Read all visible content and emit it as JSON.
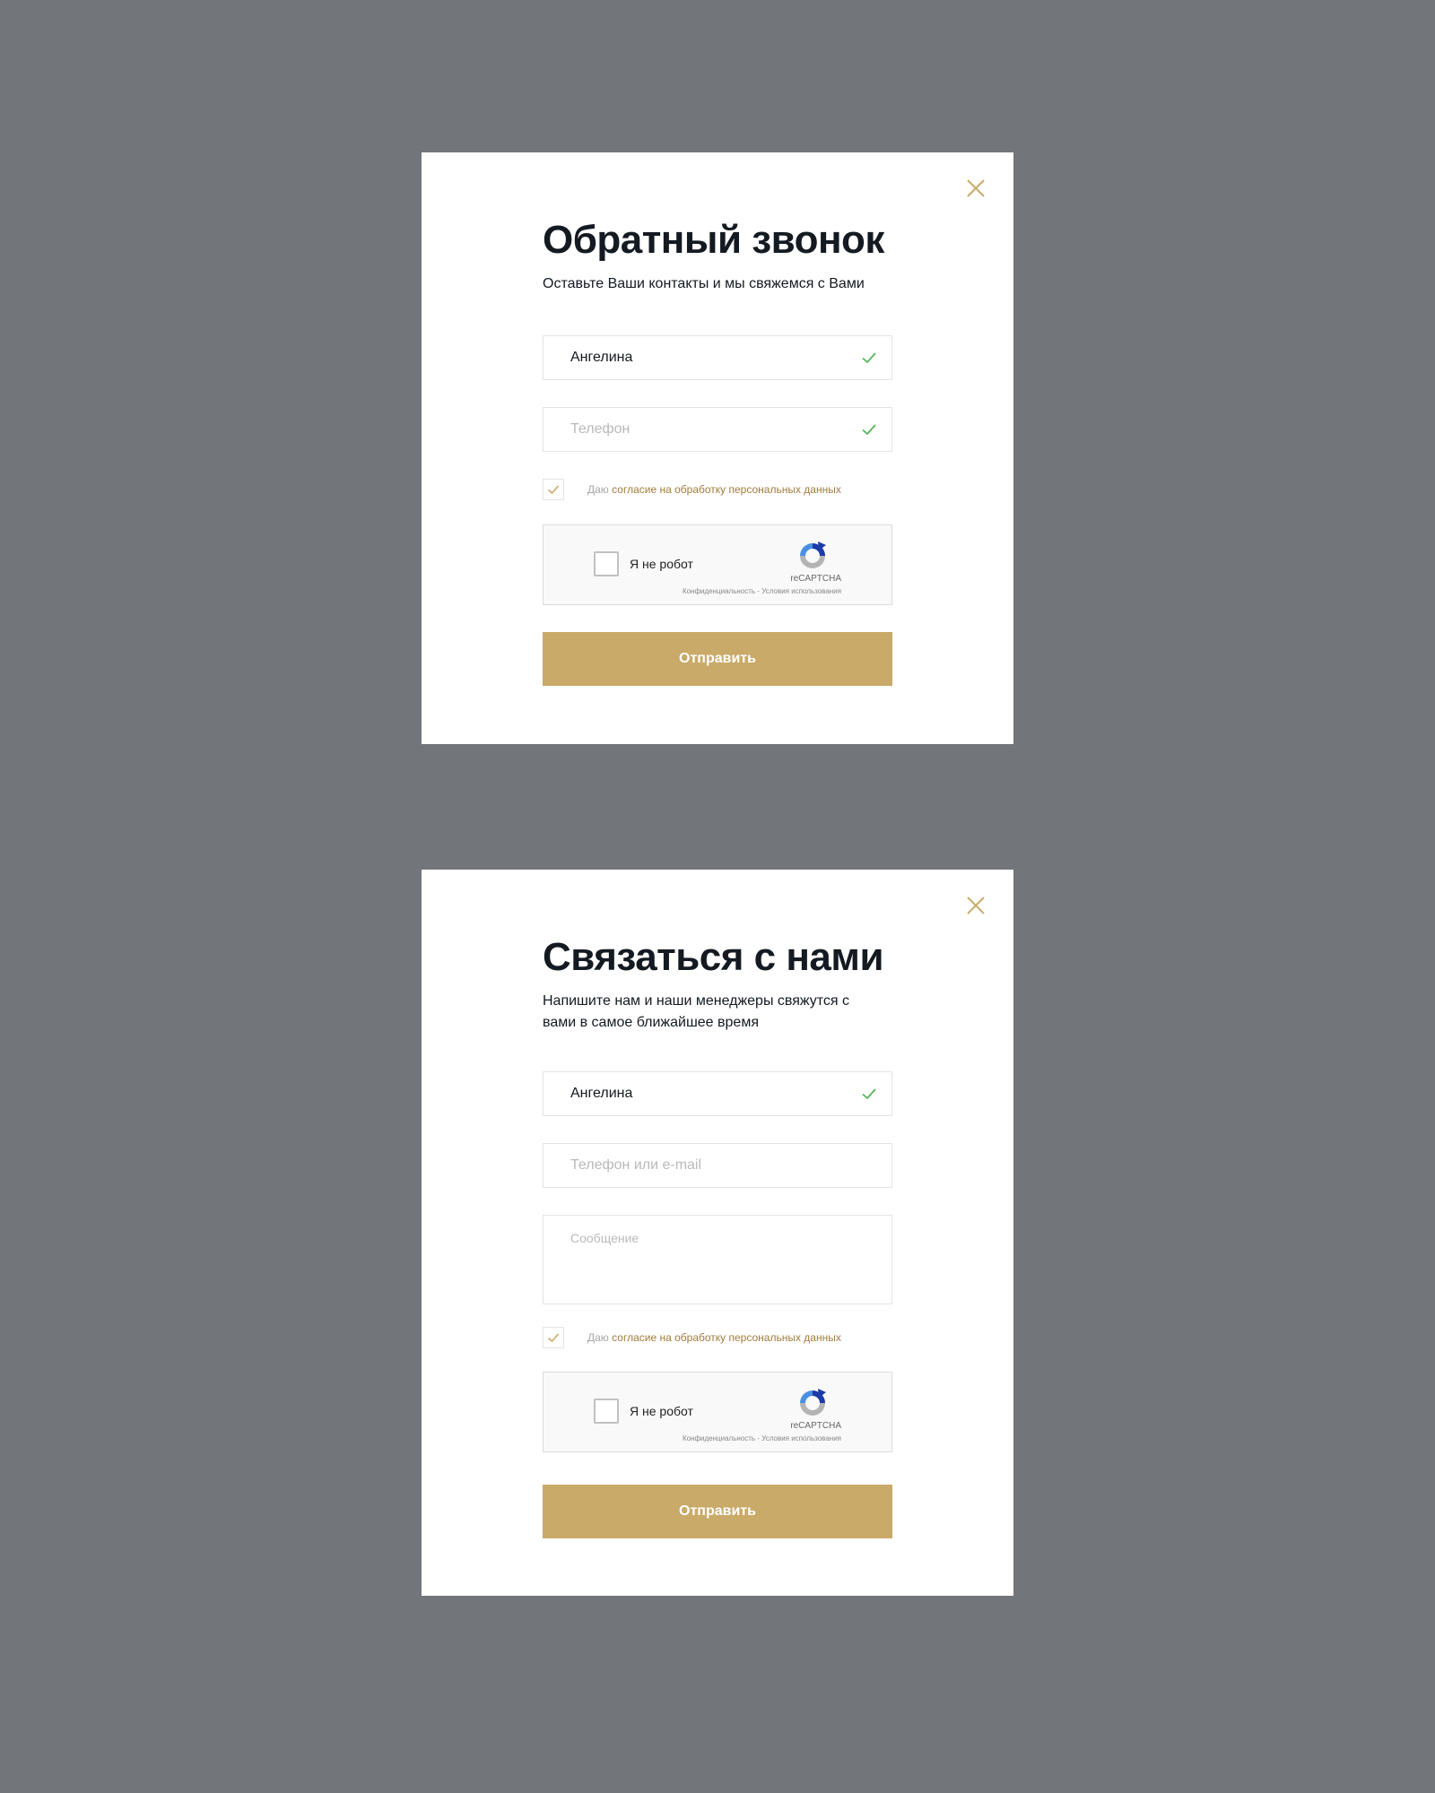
{
  "colors": {
    "background": "#72757a",
    "accent": "#c9aa69",
    "check": "#5ab35a",
    "link": "#a07c3c"
  },
  "callback_modal": {
    "close_icon": "close-icon",
    "title": "Обратный звонок",
    "subtitle": "Оставьте Ваши контакты и мы свяжемся с Вами",
    "name_field": {
      "value": "Ангелина",
      "valid": true
    },
    "phone_field": {
      "placeholder": "Телефон",
      "valid": true
    },
    "consent": {
      "checked": true,
      "prefix": "Даю",
      "link": "согласие на обработку персональных данных"
    },
    "recaptcha": {
      "label": "Я не робот",
      "brand": "reCAPTCHA",
      "links": "Конфиденциальность - Условия использования"
    },
    "submit_label": "Отправить"
  },
  "contact_modal": {
    "close_icon": "close-icon",
    "title": "Связаться с нами",
    "subtitle_line1": "Напишите нам и наши менеджеры свяжутся с",
    "subtitle_line2": "вами в самое ближайшее время",
    "name_field": {
      "value": "Ангелина",
      "valid": true
    },
    "contact_field": {
      "placeholder": "Телефон или e-mail"
    },
    "message_field": {
      "placeholder": "Сообщение"
    },
    "consent": {
      "checked": true,
      "prefix": "Даю",
      "link": "согласие на обработку персональных данных"
    },
    "recaptcha": {
      "label": "Я не робот",
      "brand": "reCAPTCHA",
      "links": "Конфиденциальность - Условия использования"
    },
    "submit_label": "Отправить"
  }
}
